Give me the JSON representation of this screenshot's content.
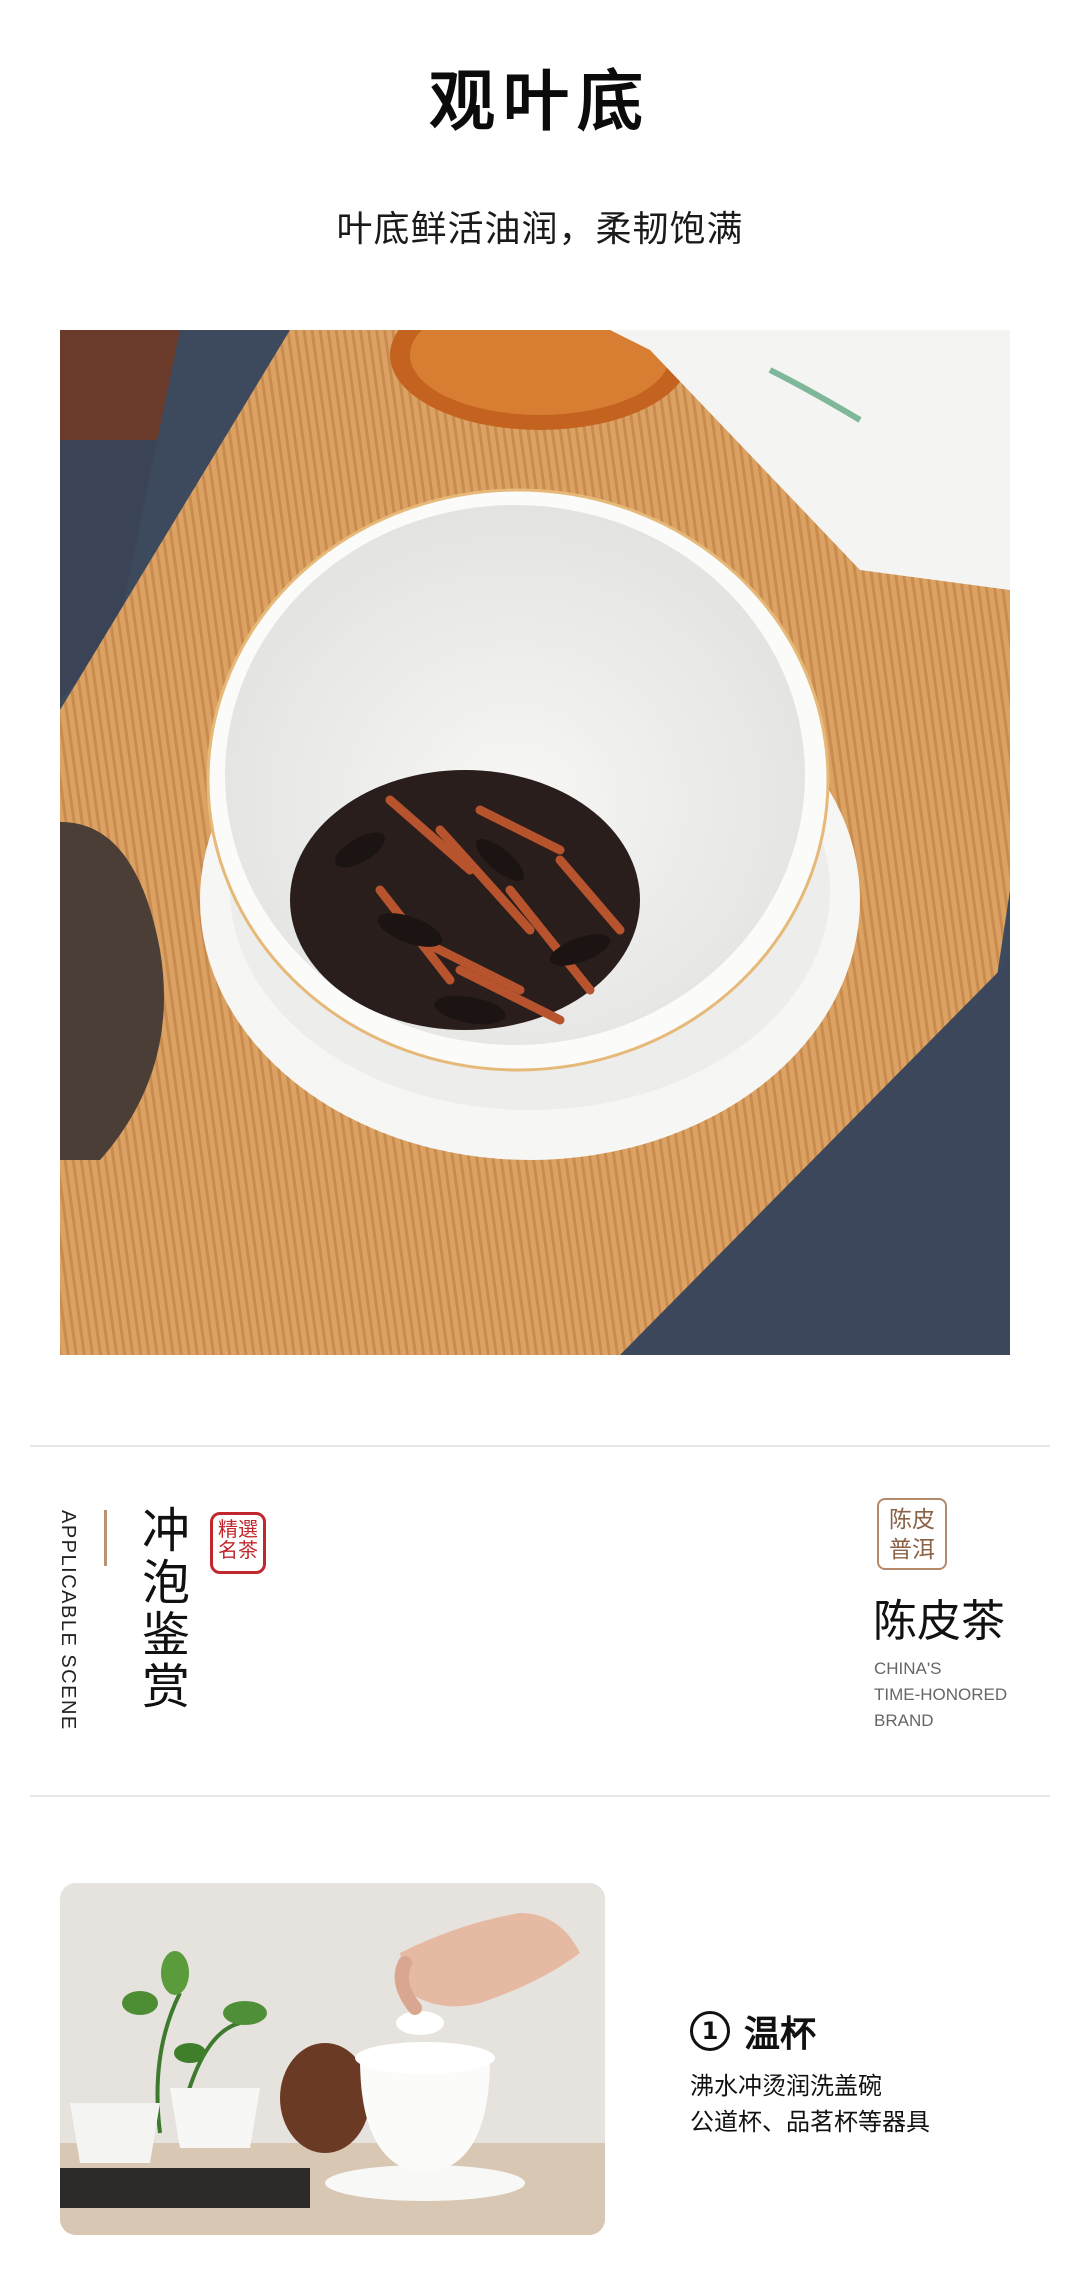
{
  "section": {
    "title": "观叶底",
    "subtitle": "叶底鲜活油润，柔韧饱满"
  },
  "scene": {
    "en_label": "APPLICABLE SCENE",
    "cn_label": "冲泡鉴赏",
    "seal_lines": [
      "精選",
      "名茶"
    ]
  },
  "brand": {
    "badge_lines": [
      "陈皮",
      "普洱"
    ],
    "name": "陈皮茶",
    "tagline": [
      "CHINA'S",
      "TIME-HONORED",
      "BRAND"
    ]
  },
  "step1": {
    "number": "1",
    "title": "温杯",
    "desc": [
      "沸水冲烫润洗盖碗",
      "公道杯、品茗杯等器具"
    ]
  },
  "icons": {
    "step_badge": "circled-number-icon",
    "seal": "seal-stamp-icon"
  },
  "colors": {
    "accent": "#b89272",
    "seal_red": "#c2272d",
    "badge_brown": "#8a6247"
  }
}
